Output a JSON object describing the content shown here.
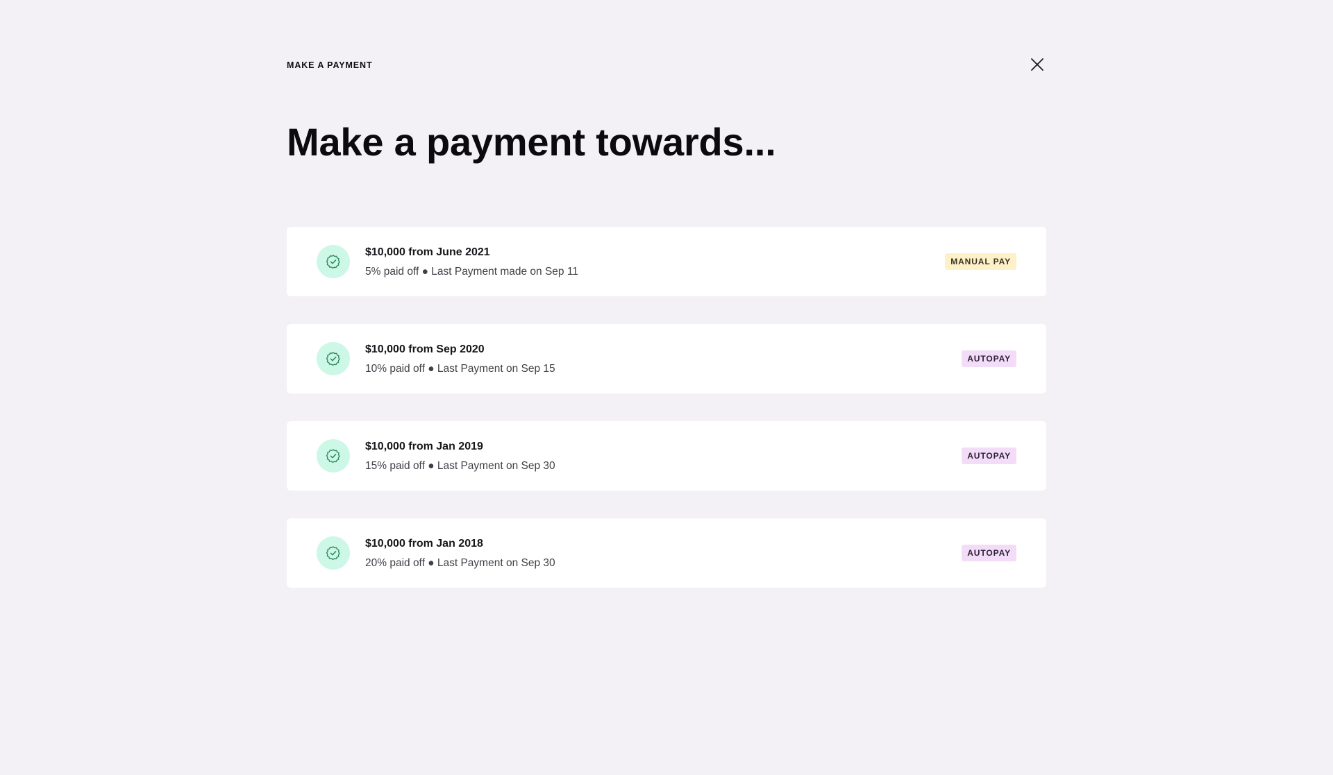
{
  "header": {
    "label": "MAKE A PAYMENT",
    "close_icon": "close-icon"
  },
  "title": "Make a payment towards...",
  "loans": [
    {
      "title": "$10,000 from June 2021",
      "subtitle": "5% paid off ● Last Payment made on Sep 11",
      "badge": "MANUAL PAY",
      "badge_type": "manual",
      "icon": "check-badge-icon"
    },
    {
      "title": "$10,000 from Sep 2020",
      "subtitle": "10% paid off ● Last Payment on Sep 15",
      "badge": "AUTOPAY",
      "badge_type": "auto",
      "icon": "check-badge-icon"
    },
    {
      "title": "$10,000 from Jan 2019",
      "subtitle": "15% paid off ● Last Payment on Sep 30",
      "badge": "AUTOPAY",
      "badge_type": "auto",
      "icon": "check-badge-icon"
    },
    {
      "title": "$10,000 from Jan 2018",
      "subtitle": "20% paid off ● Last Payment on Sep 30",
      "badge": "AUTOPAY",
      "badge_type": "auto",
      "icon": "check-badge-icon"
    }
  ],
  "colors": {
    "background": "#f3f1f6",
    "card": "#ffffff",
    "icon_circle": "#cdf7e6",
    "icon_stroke": "#2e8a5f",
    "manual_badge": "#fdf1c7",
    "autopay_badge": "#f3dcf7"
  }
}
